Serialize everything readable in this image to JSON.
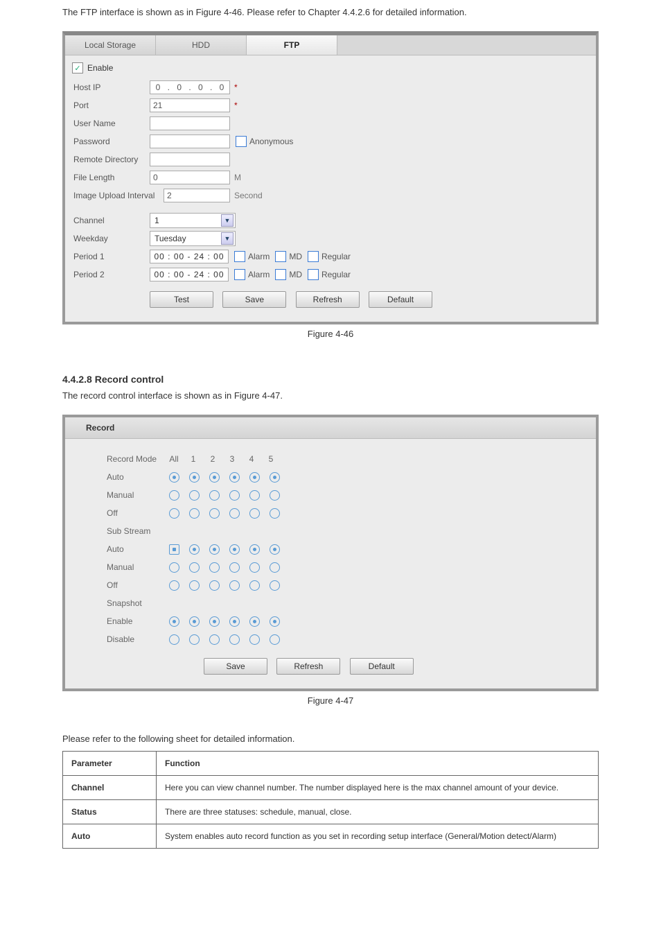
{
  "ftpSection": {
    "intro": "The FTP interface is shown as in Figure 4-46. Please refer to Chapter 4.4.2.6 for detailed information.",
    "tabs": [
      "Local Storage",
      "HDD",
      "FTP"
    ],
    "activeTab": 2,
    "enable": {
      "label": "Enable",
      "checked": true
    },
    "hostIp": {
      "label": "Host IP",
      "a": "0",
      "b": "0",
      "c": "0",
      "d": "0"
    },
    "port": {
      "label": "Port",
      "value": "21"
    },
    "userName": {
      "label": "User Name",
      "value": ""
    },
    "password": {
      "label": "Password",
      "value": "",
      "anon": "Anonymous"
    },
    "remoteDir": {
      "label": "Remote Directory",
      "value": ""
    },
    "fileLength": {
      "label": "File Length",
      "value": "0",
      "unit": "M"
    },
    "imageUpload": {
      "label": "Image Upload Interval",
      "value": "2",
      "unit": "Second"
    },
    "channel": {
      "label": "Channel",
      "value": "1"
    },
    "weekday": {
      "label": "Weekday",
      "value": "Tuesday"
    },
    "period1": {
      "label": "Period 1",
      "time": "00 : 00 - 24 : 00",
      "alarm": "Alarm",
      "md": "MD",
      "regular": "Regular"
    },
    "period2": {
      "label": "Period 2",
      "time": "00 : 00 - 24 : 00",
      "alarm": "Alarm",
      "md": "MD",
      "regular": "Regular"
    },
    "buttons": {
      "test": "Test",
      "save": "Save",
      "refresh": "Refresh",
      "default": "Default"
    },
    "caption": "Figure 4-46"
  },
  "recordSection": {
    "heading": "4.4.2.8 Record control",
    "intro": "The record control interface is shown as in Figure 4-47.",
    "title": "Record",
    "header": {
      "label": "Record Mode",
      "cols": [
        "All",
        "1",
        "2",
        "3",
        "4",
        "5"
      ]
    },
    "groups": [
      {
        "label": "Auto",
        "sel": [
          1,
          1,
          1,
          1,
          1,
          1
        ],
        "firstSquare": false
      },
      {
        "label": "Manual",
        "sel": [
          0,
          0,
          0,
          0,
          0,
          0
        ]
      },
      {
        "label": "Off",
        "sel": [
          0,
          0,
          0,
          0,
          0,
          0
        ]
      },
      {
        "label": "Sub Stream",
        "divider": true
      },
      {
        "label": "Auto",
        "sel": [
          1,
          1,
          1,
          1,
          1,
          1
        ],
        "firstSquare": true
      },
      {
        "label": "Manual",
        "sel": [
          0,
          0,
          0,
          0,
          0,
          0
        ]
      },
      {
        "label": "Off",
        "sel": [
          0,
          0,
          0,
          0,
          0,
          0
        ]
      },
      {
        "label": "Snapshot",
        "divider": true
      },
      {
        "label": "Enable",
        "sel": [
          1,
          1,
          1,
          1,
          1,
          1
        ]
      },
      {
        "label": "Disable",
        "sel": [
          0,
          0,
          0,
          0,
          0,
          0
        ]
      }
    ],
    "buttons": {
      "save": "Save",
      "refresh": "Refresh",
      "default": "Default"
    },
    "caption": "Figure 4-47"
  },
  "tableSection": {
    "intro": "Please refer to the following sheet for detailed information.",
    "head": {
      "param": "Parameter",
      "func": "Function"
    },
    "rows": [
      {
        "p": "Channel",
        "f": "Here you can view channel number. The number displayed here is the max channel amount of your device."
      },
      {
        "p": "Status",
        "f": "There are three statuses: schedule, manual, close."
      },
      {
        "p": "Auto",
        "f": "System enables auto record function as you set in recording setup interface (General/Motion detect/Alarm)"
      }
    ]
  }
}
